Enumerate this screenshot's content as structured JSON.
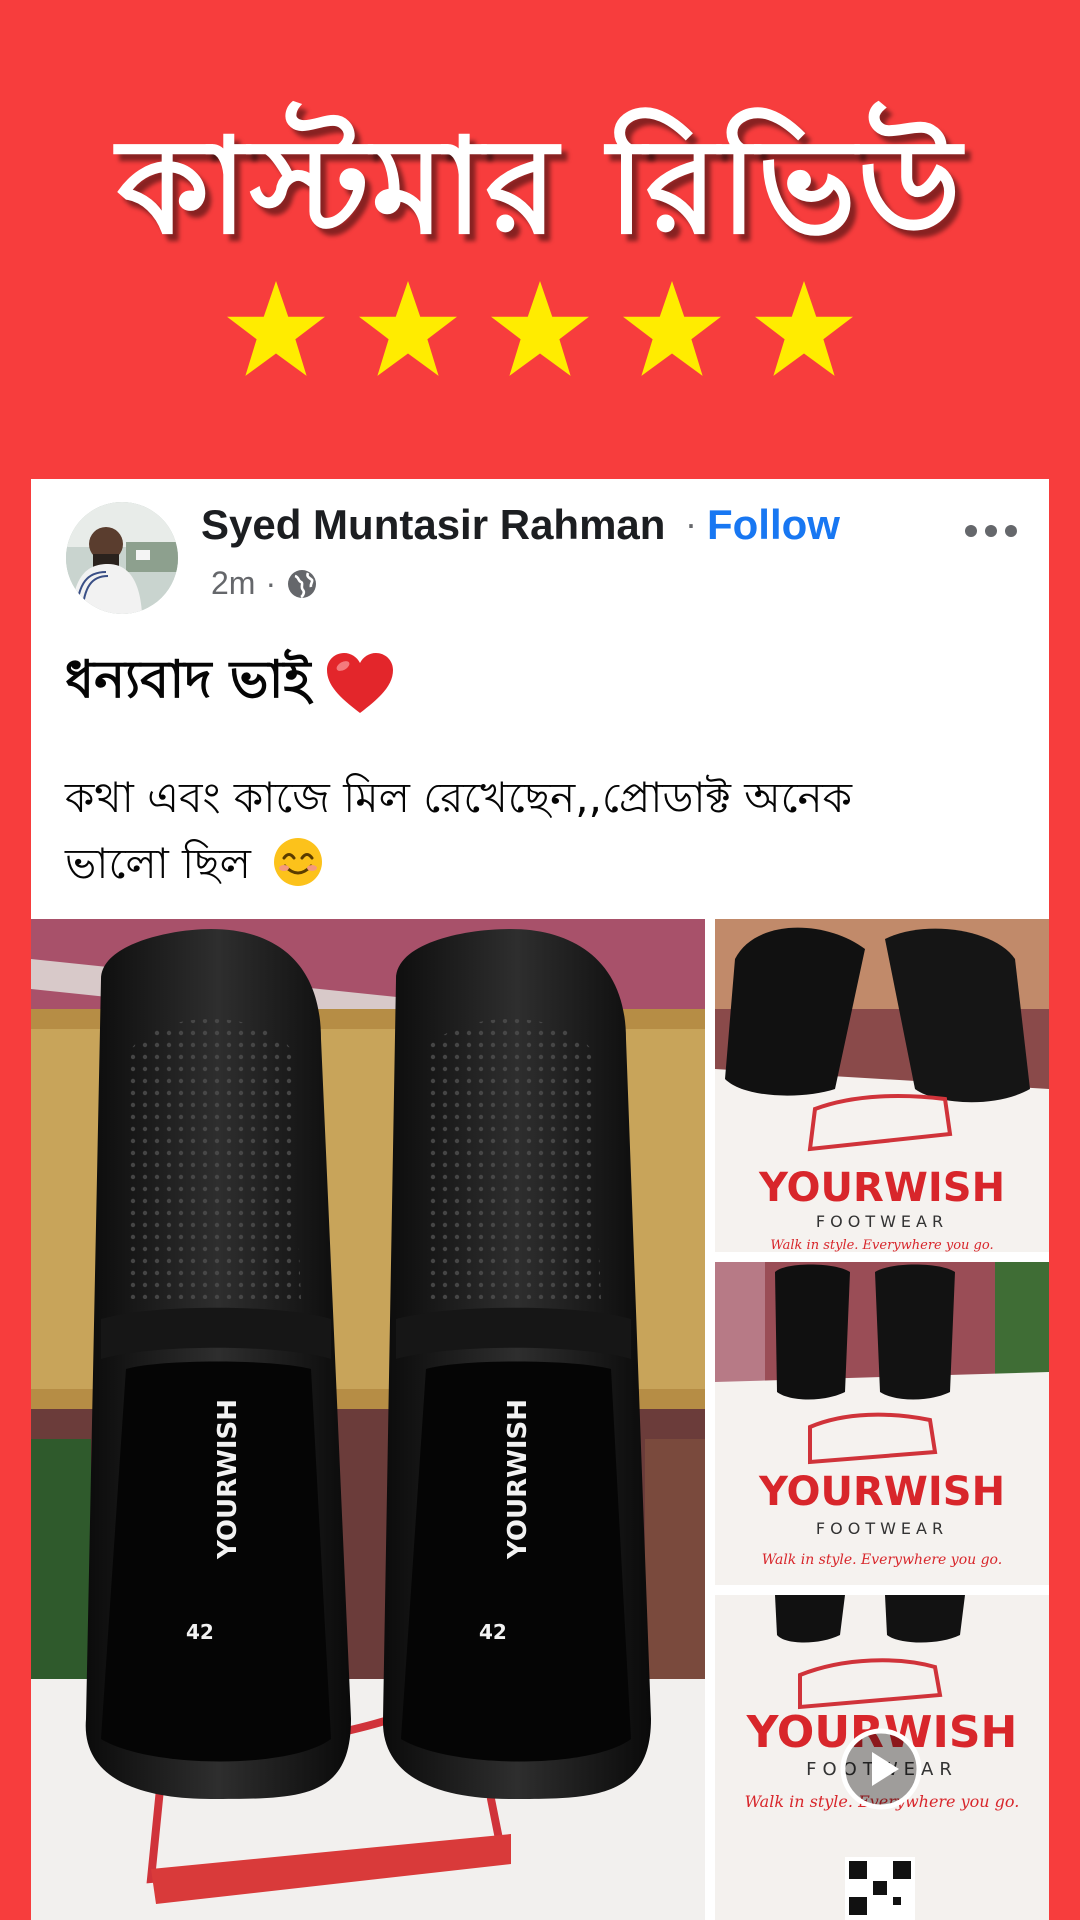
{
  "banner": {
    "title": "কাস্টমার রিভিউ",
    "rating": 5,
    "star_color": "#ffec00"
  },
  "post": {
    "author": "Syed Muntasir Rahman",
    "separator": "·",
    "follow_label": "Follow",
    "time": "2m",
    "time_separator": "·",
    "privacy_icon": "globe-icon",
    "more_icon": "more-options-icon",
    "headline": "ধন্যবাদ ভাই",
    "headline_emoji": "red-heart-icon",
    "body_line1": "কথা এবং কাজে মিল রেখেছেন,,প্রোডাক্ট  অনেক",
    "body_line2": "ভালো ছিল",
    "body_emoji": "smiling-face-icon"
  },
  "gallery": {
    "brand": "YOURWISH",
    "brand_sub": "FOOTWEAR",
    "tagline": "Walk in style. Everywhere you go.",
    "size_label": "42",
    "play_icon": "play-icon"
  },
  "colors": {
    "background": "#f73d3d",
    "follow": "#1877f2",
    "brand_red": "#d8262b"
  }
}
